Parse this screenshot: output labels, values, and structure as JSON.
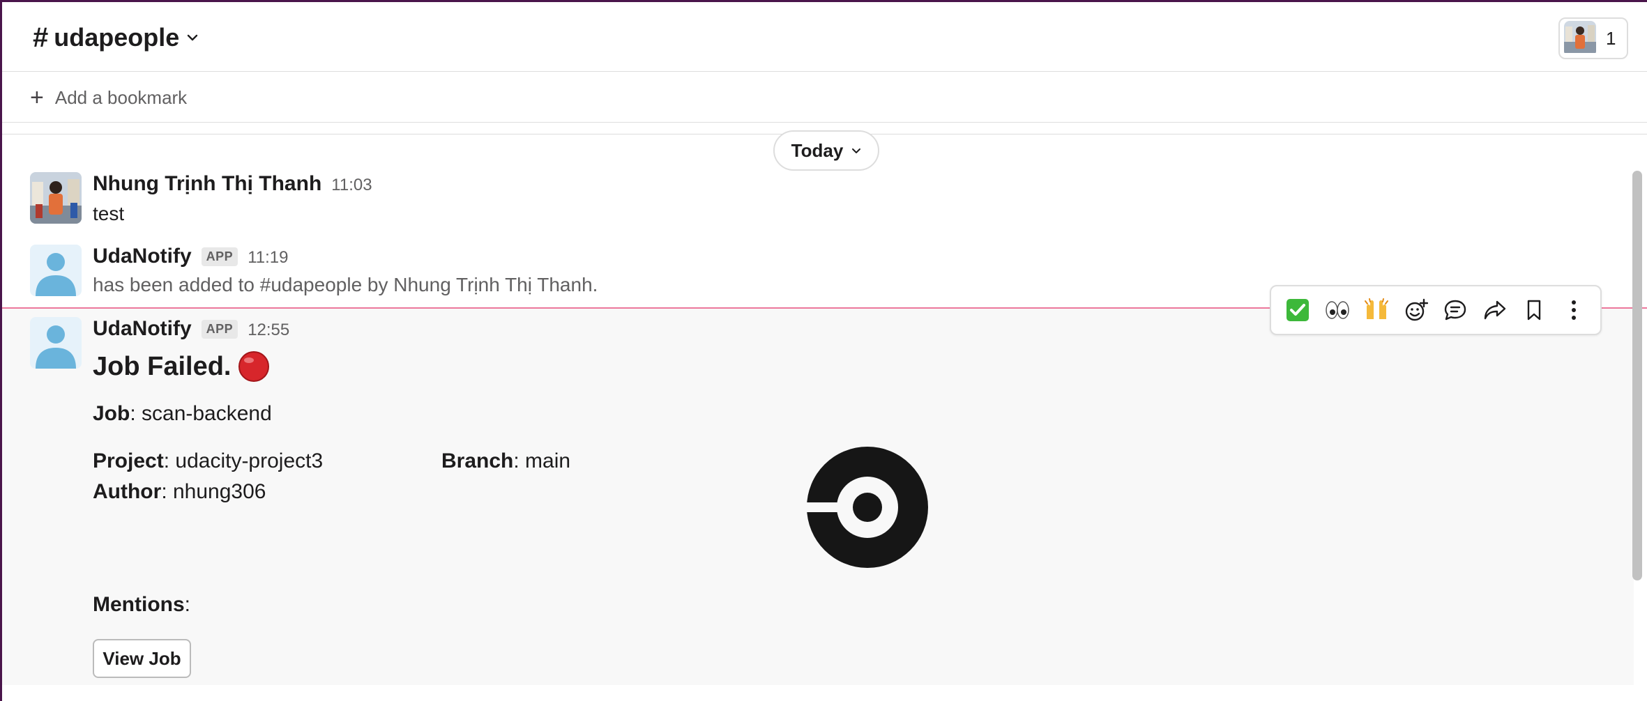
{
  "channel": {
    "hash": "#",
    "name": "udapeople",
    "member_count": "1"
  },
  "bookmark": {
    "plus": "+",
    "label": "Add a bookmark"
  },
  "day_divider": {
    "label": "Today"
  },
  "messages": [
    {
      "author": "Nhung Trịnh Thị Thanh",
      "time": "11:03",
      "text": "test"
    },
    {
      "author": "UdaNotify",
      "badge": "APP",
      "time": "11:19",
      "text": "has been added to #udapeople by Nhung Trịnh Thị Thanh."
    },
    {
      "author": "UdaNotify",
      "badge": "APP",
      "time": "12:55"
    }
  ],
  "job": {
    "title": "Job Failed.",
    "status_icon": "red-circle-icon",
    "job_label": "Job",
    "job_value": ": scan-backend",
    "project_label": "Project",
    "project_value": ": udacity-project3",
    "branch_label": "Branch",
    "branch_value": ": main",
    "author_label": "Author",
    "author_value": ": nhung306",
    "mentions_label": "Mentions",
    "mentions_value": ":",
    "button": "View Job"
  },
  "toolbar": {
    "icons": [
      "white-check-mark-icon",
      "eyes-icon",
      "raised-hands-icon",
      "add-reaction-icon",
      "reply-in-thread-icon",
      "forward-icon",
      "save-bookmark-icon",
      "more-actions-icon"
    ],
    "check": "✅",
    "eyes": "👀",
    "hands": "🙌"
  },
  "colors": {
    "workspace_accent": "#4a154b",
    "new_messages_line": "#e01e5a",
    "default_avatar": "#6ab4dc"
  }
}
